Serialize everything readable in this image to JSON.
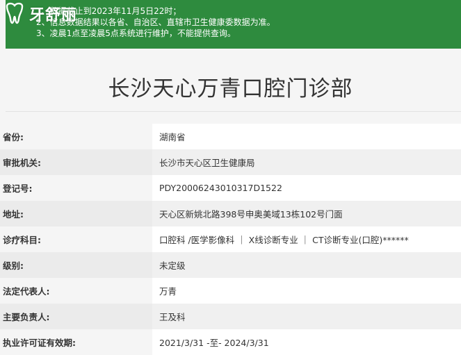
{
  "notice": {
    "lines": [
      "1、数据截止到2023年11月5日22时；",
      "2、信息数据结果以各省、自治区、直辖市卫生健康委数据为准。",
      "3、凌晨1点至凌晨5点系统进行维护，不能提供查询。"
    ]
  },
  "watermark": {
    "logo_text": "牙舒丽",
    "icon": "tooth-icon"
  },
  "page": {
    "title": "长沙天心万青口腔门诊部"
  },
  "info": {
    "rows": [
      {
        "label": "省份:",
        "value": "湖南省"
      },
      {
        "label": "审批机关:",
        "value": "长沙市天心区卫生健康局"
      },
      {
        "label": "登记号:",
        "value": "PDY20006243010317D1522"
      },
      {
        "label": "地址:",
        "value": "天心区新姚北路398号申奥美域13栋102号门面"
      },
      {
        "label": "诊疗科目:",
        "value": "口腔科 /医学影像科 ｜ X线诊断专业 ｜ CT诊断专业(口腔)******"
      },
      {
        "label": "级别:",
        "value": "未定级"
      },
      {
        "label": "法定代表人:",
        "value": "万青"
      },
      {
        "label": "主要负责人:",
        "value": "王及科"
      },
      {
        "label": "执业许可证有效期:",
        "value": "2021/3/31 -至- 2024/3/31"
      }
    ]
  },
  "colors": {
    "notice_bg": "#2e8b3e",
    "page_bg": "#f5f5f5"
  }
}
